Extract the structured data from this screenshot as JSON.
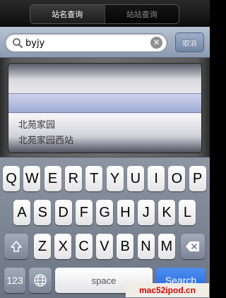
{
  "segmented": {
    "tab_station_name": "站名查询",
    "tab_station_to_station": "站站查询"
  },
  "search": {
    "value": "byjy",
    "clear_icon": "clear-icon",
    "search_icon": "search-icon",
    "cancel_label": "取消"
  },
  "picker": {
    "items": [
      "北苑家园",
      "北苑家园西站"
    ]
  },
  "keyboard": {
    "row1": [
      "Q",
      "W",
      "E",
      "R",
      "T",
      "Y",
      "U",
      "I",
      "O",
      "P"
    ],
    "row2": [
      "A",
      "S",
      "D",
      "F",
      "G",
      "H",
      "J",
      "K",
      "L"
    ],
    "row3": [
      "Z",
      "X",
      "C",
      "V",
      "B",
      "N",
      "M"
    ],
    "shift_icon": "shift-arrow-icon",
    "backspace_icon": "backspace-icon",
    "numbers_label": "123",
    "globe_icon": "globe-icon",
    "space_label": "space",
    "search_label": "Search"
  },
  "watermark": "mac52ipod.cn",
  "colors": {
    "search_key": "#2a6fe2",
    "cancel_button": "#7f94b5",
    "watermark_text": "#d90000"
  }
}
